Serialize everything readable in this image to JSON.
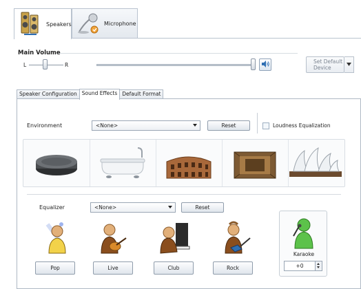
{
  "device_tabs": [
    {
      "label": "Speakers",
      "icon": "speakers-icon",
      "active": true
    },
    {
      "label": "Microphone",
      "icon": "microphone-icon",
      "active": false
    }
  ],
  "volume": {
    "title": "Main Volume",
    "left_label": "L",
    "right_label": "R",
    "balance_level": 0.5,
    "main_level": 1.0,
    "set_default_label": "Set Default\nDevice"
  },
  "sub_tabs": [
    {
      "label": "Speaker Configuration",
      "active": false
    },
    {
      "label": "Sound Effects",
      "active": true
    },
    {
      "label": "Default Format",
      "active": false
    }
  ],
  "environment": {
    "label": "Environment",
    "value": "<None>",
    "reset_label": "Reset",
    "loudness_label": "Loudness Equalization",
    "loudness_checked": false,
    "presets": [
      {
        "name": "stone-disc-icon"
      },
      {
        "name": "bathtub-icon"
      },
      {
        "name": "colosseum-icon"
      },
      {
        "name": "sewer-pipe-icon"
      },
      {
        "name": "opera-house-icon"
      }
    ]
  },
  "equalizer": {
    "label": "Equalizer",
    "value": "<None>",
    "reset_label": "Reset",
    "genres": [
      {
        "label": "Pop",
        "icon": "pop-singer-icon"
      },
      {
        "label": "Live",
        "icon": "guitarist-icon"
      },
      {
        "label": "Club",
        "icon": "pianist-icon"
      },
      {
        "label": "Rock",
        "icon": "rock-guitarist-icon"
      }
    ]
  },
  "karaoke": {
    "label": "Karaoke",
    "value": "+0",
    "icon": "karaoke-singer-icon"
  },
  "colors": {
    "accent": "#2f6fb3",
    "tab_border": "#b9c3cf"
  }
}
